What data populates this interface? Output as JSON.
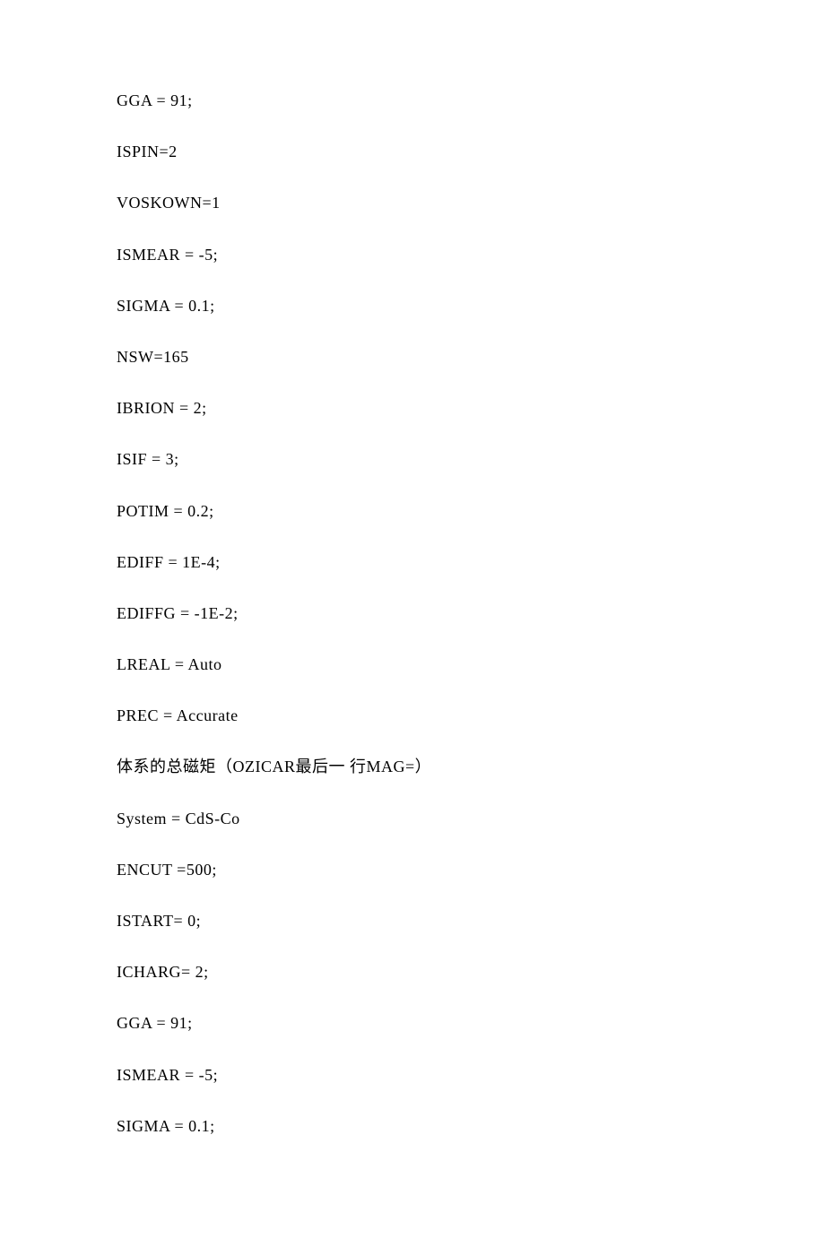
{
  "lines": [
    "GGA = 91;",
    "ISPIN=2",
    "VOSKOWN=1",
    "ISMEAR = -5;",
    "SIGMA = 0.1;",
    "NSW=165",
    "IBRION = 2;",
    "ISIF = 3;",
    "POTIM = 0.2;",
    "EDIFF = 1E-4;",
    "EDIFFG = -1E-2;",
    "LREAL = Auto",
    "PREC = Accurate",
    "体系的总磁矩（OZICAR最后一 行MAG=）",
    "System = CdS-Co",
    "ENCUT =500;",
    "ISTART= 0;",
    "ICHARG= 2;",
    "GGA = 91;",
    "ISMEAR = -5;",
    "SIGMA = 0.1;"
  ]
}
